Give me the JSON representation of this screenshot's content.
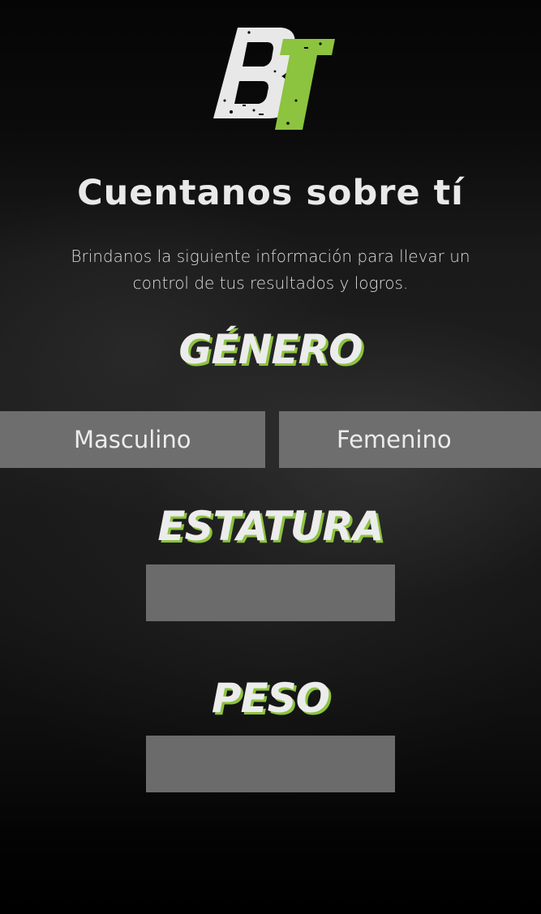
{
  "logo": {
    "letters": [
      "B",
      "T"
    ],
    "colors": {
      "b": "#e8e8e8",
      "t": "#8cc33f"
    }
  },
  "header": {
    "title": "Cuentanos sobre tí",
    "subtitle": "Brindanos la siguiente información para llevar un control de tus resultados y logros."
  },
  "gender": {
    "heading": "GÉNERO",
    "options": [
      {
        "label": "Masculino"
      },
      {
        "label": "Femenino"
      }
    ]
  },
  "height": {
    "heading": "ESTATURA",
    "value": ""
  },
  "weight": {
    "heading": "PESO",
    "value": ""
  },
  "colors": {
    "accent": "#8cc33f",
    "button_bg": "#6e6e6e",
    "text": "#e9e9e9"
  }
}
